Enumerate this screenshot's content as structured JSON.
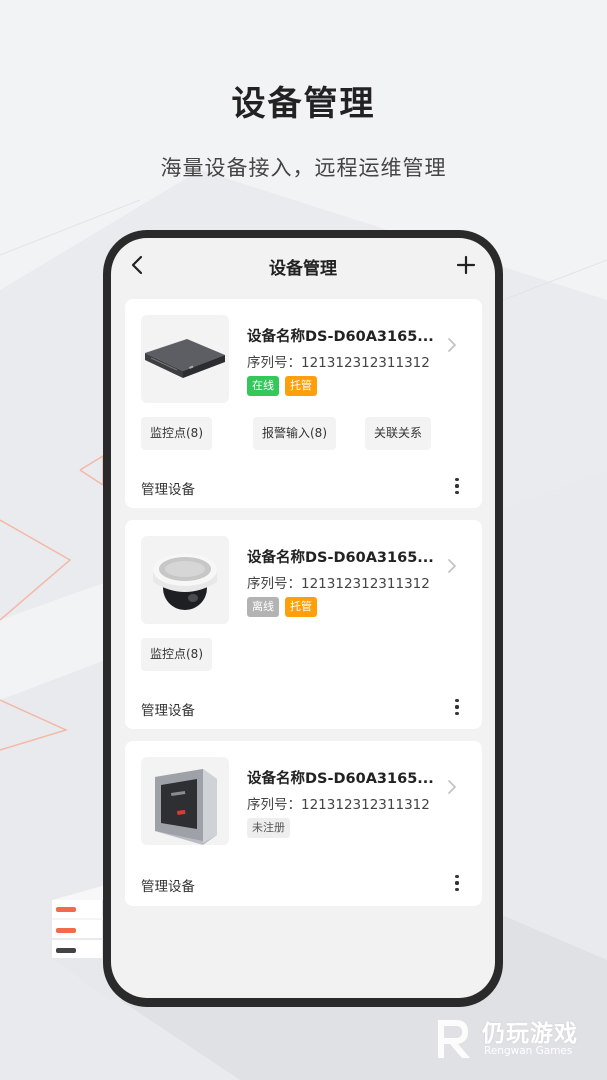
{
  "promo": {
    "title": "设备管理",
    "subtitle": "海量设备接入，远程运维管理"
  },
  "navbar": {
    "title": "设备管理",
    "back_icon": "chevron-left-icon",
    "add_icon": "plus-icon"
  },
  "devices": [
    {
      "name": "设备名称DS-D60A3165...",
      "serial": "序列号：121312312311312",
      "tags": [
        {
          "label": "在线",
          "color": "#34c759"
        },
        {
          "label": "托管",
          "color": "#ff9f0a"
        }
      ],
      "actions": [
        "监控点(8)",
        "报警输入(8)",
        "关联关系"
      ],
      "manage_label": "管理设备",
      "thumb_icon": "nvr-recorder-icon"
    },
    {
      "name": "设备名称DS-D60A3165...",
      "serial": "序列号：121312312311312",
      "tags": [
        {
          "label": "离线",
          "color": "#b3b3b3"
        },
        {
          "label": "托管",
          "color": "#ff9f0a"
        }
      ],
      "actions": [
        "监控点(8)"
      ],
      "manage_label": "管理设备",
      "thumb_icon": "dome-camera-icon"
    },
    {
      "name": "设备名称DS-D60A3165...",
      "serial": "序列号：121312312311312",
      "tags": [
        {
          "label": "未注册",
          "color": "#eeeeee"
        }
      ],
      "actions": [],
      "manage_label": "管理设备",
      "thumb_icon": "access-control-panel-icon"
    }
  ],
  "watermark": {
    "name_cn": "仍玩游戏",
    "name_en": "Rengwan Games"
  }
}
